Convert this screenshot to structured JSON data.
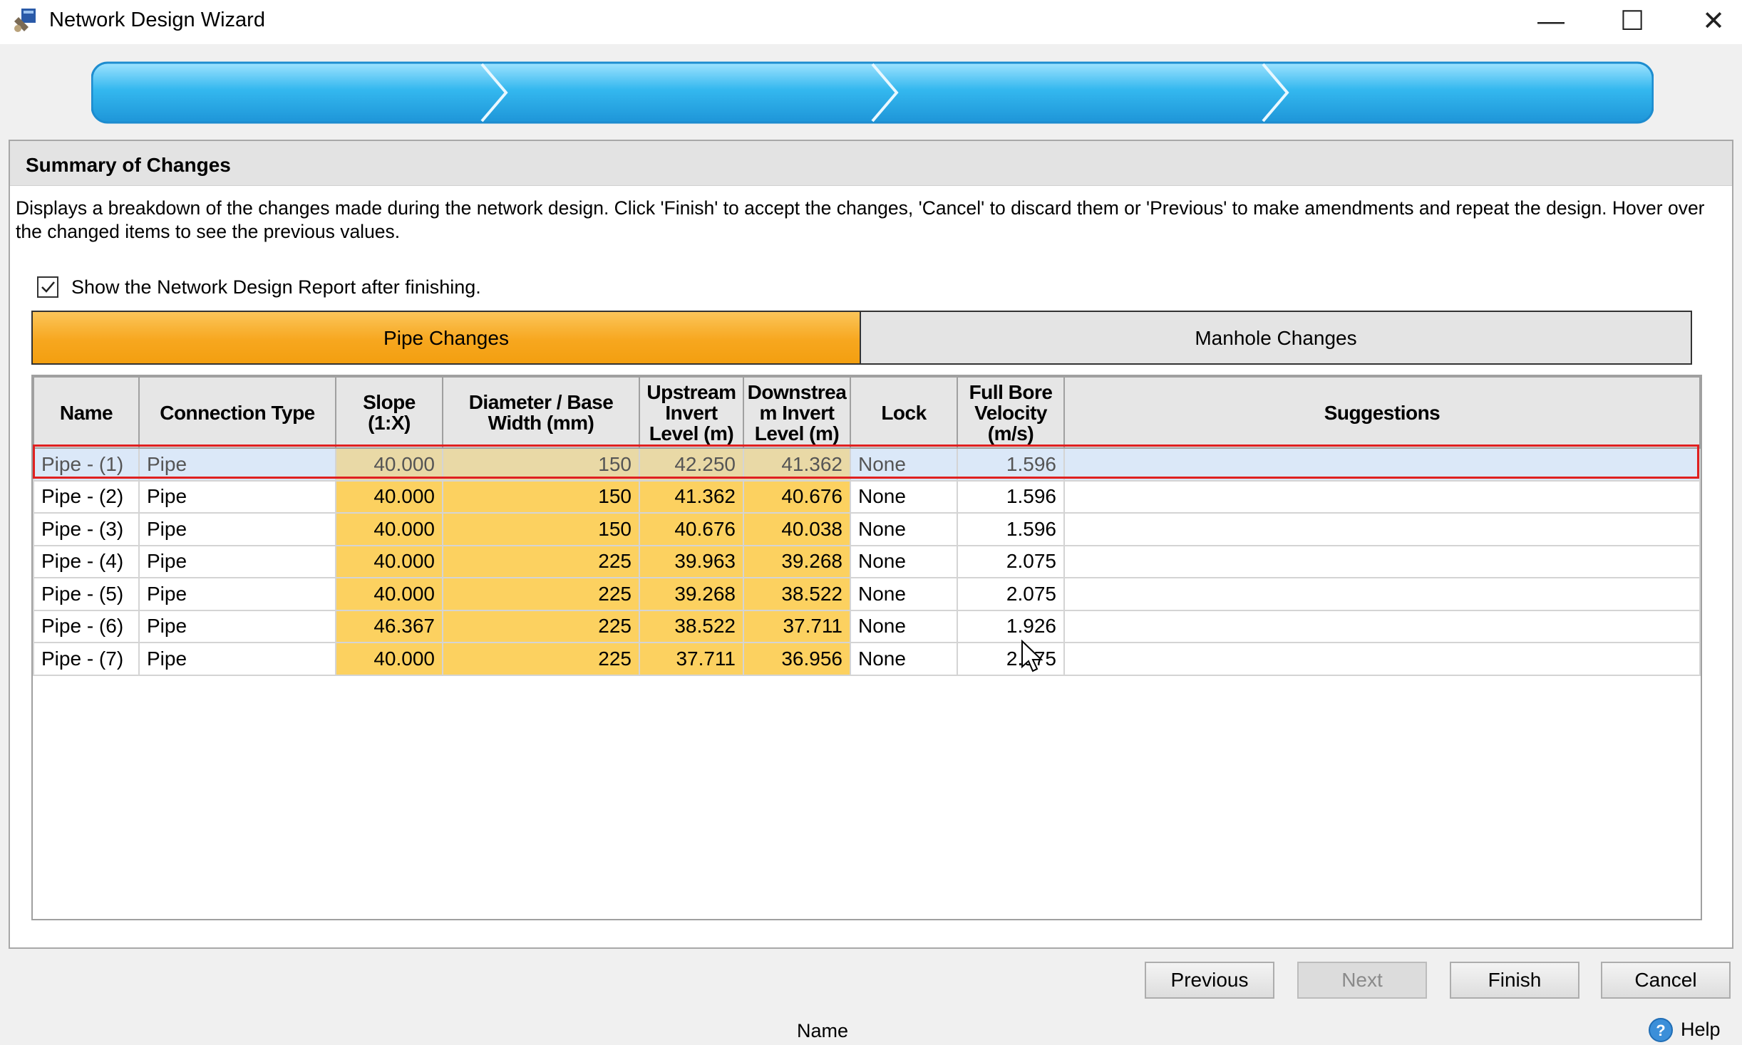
{
  "window": {
    "title": "Network Design Wizard",
    "minimize_glyph": "—",
    "maximize_glyph": "☐",
    "close_glyph": "✕"
  },
  "wizard_steps": {
    "count": 4,
    "current": 4,
    "color": "#34b8ef"
  },
  "section": {
    "title": "Summary of Changes",
    "description": "Displays a breakdown of the changes made during the network design. Click 'Finish' to accept the changes, 'Cancel' to discard them or 'Previous' to make amendments and repeat the design. Hover over the changed items to see the previous values."
  },
  "show_report": {
    "label": "Show the Network Design Report after finishing.",
    "checked": true
  },
  "tabs": [
    {
      "label": "Pipe Changes",
      "active": true,
      "color": "#f7a71f"
    },
    {
      "label": "Manhole Changes",
      "active": false
    }
  ],
  "table": {
    "columns": [
      "Name",
      "Connection Type",
      "Slope\n(1:X)",
      "Diameter / Base\nWidth (mm)",
      "Upstream\nInvert\nLevel (m)",
      "Downstrea\nm Invert\nLevel (m)",
      "Lock",
      "Full Bore\nVelocity\n(m/s)",
      "Suggestions"
    ],
    "highlight_color": "#fcd160",
    "selected_row": 0,
    "rows": [
      [
        "Pipe - (1)",
        "Pipe",
        "40.000",
        "150",
        "42.250",
        "41.362",
        "None",
        "1.596",
        ""
      ],
      [
        "Pipe - (2)",
        "Pipe",
        "40.000",
        "150",
        "41.362",
        "40.676",
        "None",
        "1.596",
        ""
      ],
      [
        "Pipe - (3)",
        "Pipe",
        "40.000",
        "150",
        "40.676",
        "40.038",
        "None",
        "1.596",
        ""
      ],
      [
        "Pipe - (4)",
        "Pipe",
        "40.000",
        "225",
        "39.963",
        "39.268",
        "None",
        "2.075",
        ""
      ],
      [
        "Pipe - (5)",
        "Pipe",
        "40.000",
        "225",
        "39.268",
        "38.522",
        "None",
        "2.075",
        ""
      ],
      [
        "Pipe - (6)",
        "Pipe",
        "46.367",
        "225",
        "38.522",
        "37.711",
        "None",
        "1.926",
        ""
      ],
      [
        "Pipe - (7)",
        "Pipe",
        "40.000",
        "225",
        "37.711",
        "36.956",
        "None",
        "2.075",
        ""
      ]
    ]
  },
  "buttons": {
    "previous": "Previous",
    "next": "Next",
    "finish": "Finish",
    "cancel": "Cancel"
  },
  "status": {
    "name_label": "Name",
    "help_label": "Help"
  }
}
